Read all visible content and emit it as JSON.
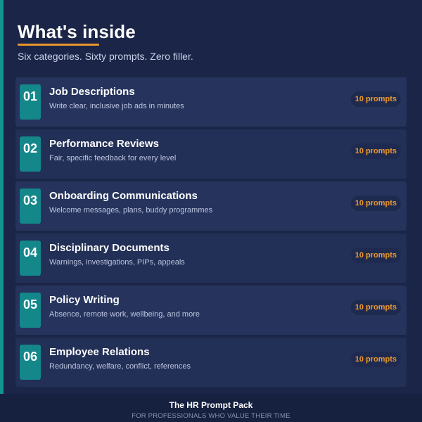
{
  "header": {
    "title": "What's inside",
    "subtitle": "Six categories. Sixty prompts. Zero filler."
  },
  "categories": [
    {
      "number": "01",
      "title": "Job Descriptions",
      "description": "Write clear, inclusive job ads in minutes",
      "badge": "10 prompts"
    },
    {
      "number": "02",
      "title": "Performance Reviews",
      "description": "Fair, specific feedback for every level",
      "badge": "10 prompts"
    },
    {
      "number": "03",
      "title": "Onboarding Communications",
      "description": "Welcome messages, plans, buddy programmes",
      "badge": "10 prompts"
    },
    {
      "number": "04",
      "title": "Disciplinary Documents",
      "description": "Warnings, investigations, PIPs, appeals",
      "badge": "10 prompts"
    },
    {
      "number": "05",
      "title": "Policy Writing",
      "description": "Absence, remote work, wellbeing, and more",
      "badge": "10 prompts"
    },
    {
      "number": "06",
      "title": "Employee Relations",
      "description": "Redundancy, welfare, conflict, references",
      "badge": "10 prompts"
    }
  ],
  "footer": {
    "title": "The HR Prompt Pack",
    "tagline": "FOR PROFESSIONALS WHO VALUE THEIR TIME"
  },
  "colors": {
    "background": "#1b2547",
    "card": "#26345d",
    "accent_teal": "#15948f",
    "accent_orange": "#e8962c"
  }
}
